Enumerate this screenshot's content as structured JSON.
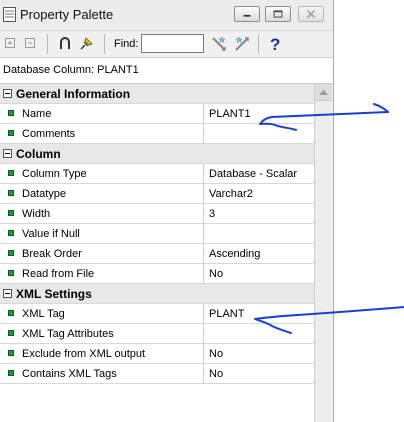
{
  "window": {
    "title": "Property Palette",
    "icons": {
      "app": "palette-app-icon",
      "minimize": "minimize-icon",
      "maximize": "maximize-icon",
      "close": "close-icon"
    }
  },
  "toolbar": {
    "expand_icon": "expand-all-icon",
    "collapse_icon": "collapse-all-icon",
    "union_icon": "union-icon",
    "pin_icon": "pin-icon",
    "find_label": "Find:",
    "find_value": "",
    "find_next_icon": "find-next-icon",
    "find_prev_icon": "find-previous-icon",
    "help_icon": "help-icon"
  },
  "header": "Database Column: PLANT1",
  "sections": [
    {
      "label": "General Information",
      "rows": [
        {
          "name": "Name",
          "value": "PLANT1"
        },
        {
          "name": "Comments",
          "value": ""
        }
      ]
    },
    {
      "label": "Column",
      "rows": [
        {
          "name": "Column Type",
          "value": "Database - Scalar"
        },
        {
          "name": "Datatype",
          "value": "Varchar2"
        },
        {
          "name": "Width",
          "value": "3"
        },
        {
          "name": "Value if Null",
          "value": ""
        },
        {
          "name": "Break Order",
          "value": "Ascending"
        },
        {
          "name": "Read from File",
          "value": "No"
        }
      ]
    },
    {
      "label": "XML Settings",
      "rows": [
        {
          "name": "XML Tag",
          "value": "PLANT"
        },
        {
          "name": "XML Tag Attributes",
          "value": ""
        },
        {
          "name": "Exclude from XML output",
          "value": "No"
        },
        {
          "name": "Contains XML Tags",
          "value": "No"
        }
      ]
    }
  ],
  "colors": {
    "bullet": "#1f9a37",
    "annotation": "#1a3fd6",
    "category_bg": "#e8e8e8"
  }
}
